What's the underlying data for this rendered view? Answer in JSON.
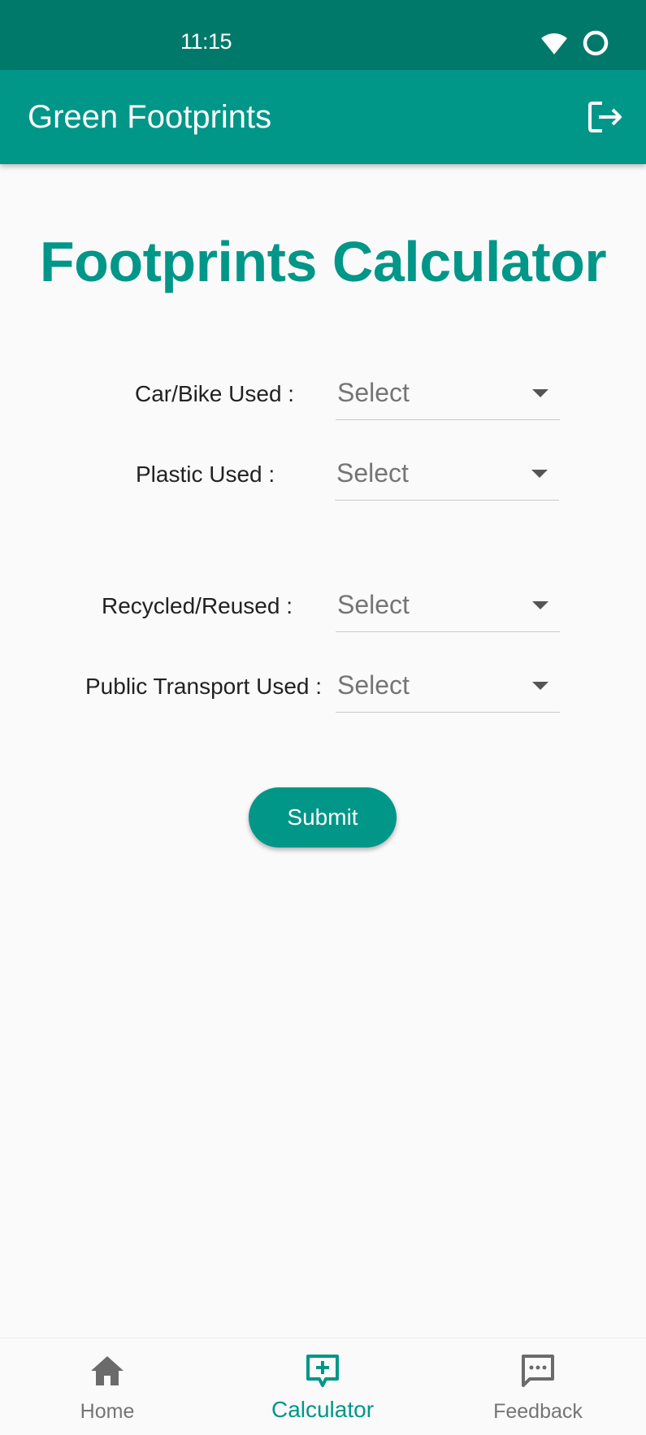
{
  "status_bar": {
    "time": "11:15"
  },
  "app_bar": {
    "title": "Green Footprints"
  },
  "main": {
    "heading": "Footprints Calculator",
    "fields": [
      {
        "label": "Car/Bike Used :",
        "value": "Select"
      },
      {
        "label": "Plastic Used :",
        "value": "Select"
      },
      {
        "label": "Recycled/Reused :",
        "value": "Select"
      },
      {
        "label": "Public Transport Used :",
        "value": "Select"
      }
    ],
    "submit_label": "Submit"
  },
  "bottom_nav": {
    "items": [
      {
        "label": "Home",
        "icon": "home-icon",
        "active": false
      },
      {
        "label": "Calculator",
        "icon": "add-box-icon",
        "active": true
      },
      {
        "label": "Feedback",
        "icon": "chat-icon",
        "active": false
      }
    ]
  },
  "colors": {
    "primary": "#009688",
    "primary_dark": "#00796b",
    "inactive": "#757575",
    "background": "#fafafa"
  }
}
